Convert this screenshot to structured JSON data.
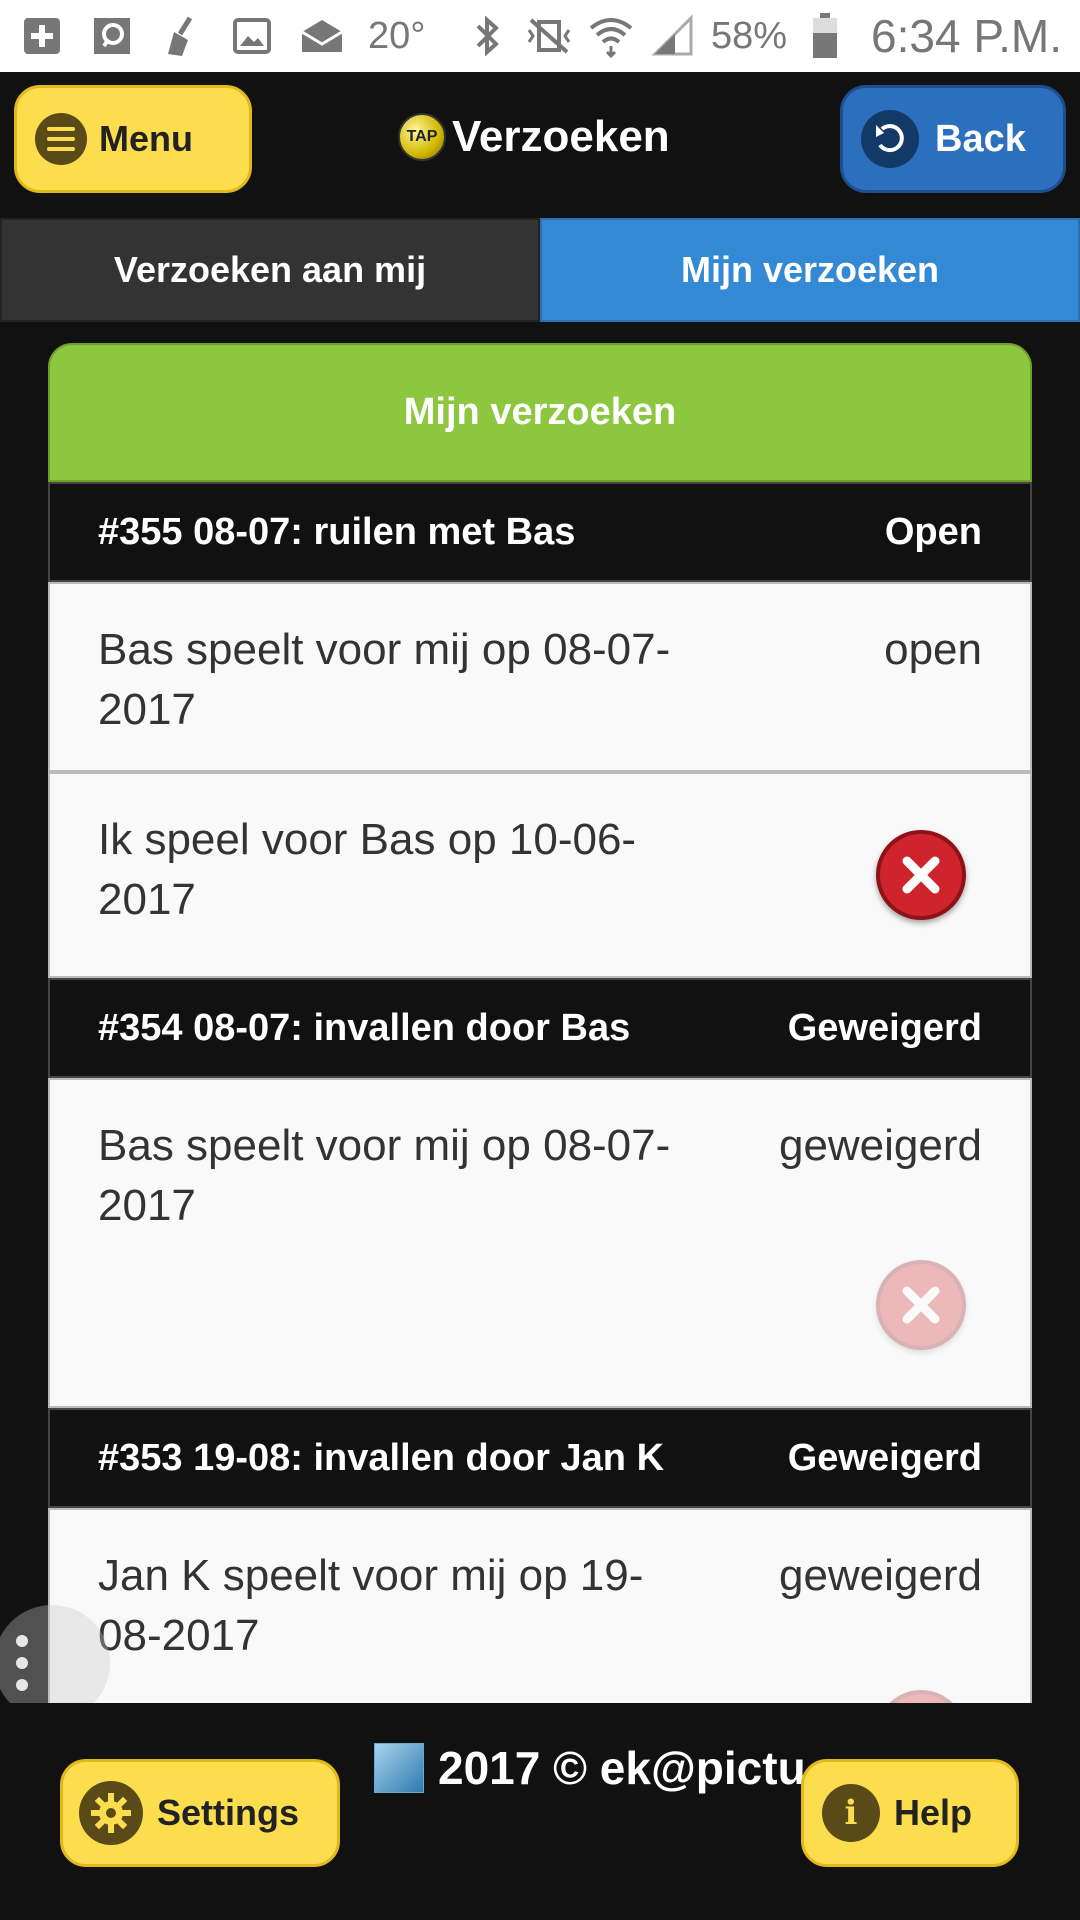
{
  "status_bar": {
    "icons": [
      "add-icon",
      "message-icon",
      "broom-icon",
      "image-icon",
      "mail-icon"
    ],
    "temperature": "20°",
    "battery": "58%",
    "time": "6:34 P.M."
  },
  "header": {
    "menu_label": "Menu",
    "logo_text": "TAP",
    "title": "Verzoeken",
    "back_label": "Back"
  },
  "tabs": [
    {
      "label": "Verzoeken aan mij",
      "active": false
    },
    {
      "label": "Mijn verzoeken",
      "active": true
    }
  ],
  "card": {
    "title": "Mijn verzoeken",
    "groups": [
      {
        "title": "#355 08-07: ruilen met Bas",
        "status": "Open",
        "rows": [
          {
            "text": "Bas speelt voor mij op 08-07-2017",
            "status": "open",
            "action": null
          },
          {
            "text": "Ik speel voor Bas op 10-06-2017",
            "status": "",
            "action": "cancel"
          }
        ]
      },
      {
        "title": "#354 08-07: invallen door Bas",
        "status": "Geweigerd",
        "rows": [
          {
            "text": "Bas speelt voor mij op 08-07-2017",
            "status": "geweigerd",
            "action": "cancel-disabled"
          }
        ]
      },
      {
        "title": "#353 19-08: invallen door Jan K",
        "status": "Geweigerd",
        "rows": [
          {
            "text": "Jan K speelt voor mij op 19-08-2017",
            "status": "geweigerd",
            "action": "cancel-disabled"
          }
        ]
      }
    ]
  },
  "footer": {
    "copyright": "2017 © ek@pictu",
    "settings_label": "Settings",
    "help_label": "Help"
  },
  "colors": {
    "accent_yellow": "#fbdd4e",
    "accent_blue": "#3489d4",
    "header_green": "#8dc63f",
    "cancel_red": "#d0242c"
  }
}
